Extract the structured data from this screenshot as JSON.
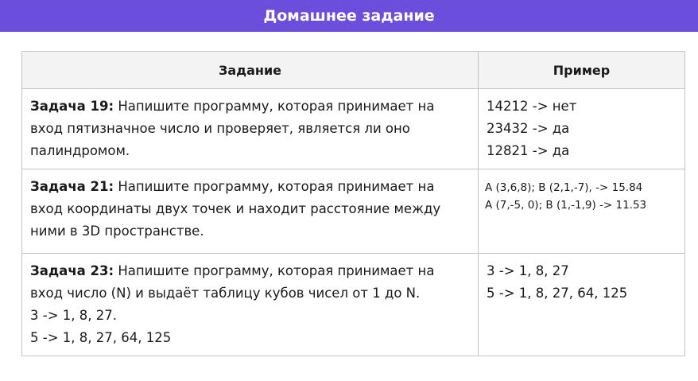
{
  "header": {
    "title": "Домашнее задание"
  },
  "table": {
    "columns": [
      "Задание",
      "Пример"
    ],
    "rows": [
      {
        "label": "Задача 19:",
        "text": " Напишите программу, которая принимает на вход пятизначное число и проверяет, является ли оно палиндромом.",
        "examples": [
          "14212 -> нет",
          "23432 -> да",
          "12821 -> да"
        ]
      },
      {
        "label": "Задача 21:",
        "text": " Напишите программу, которая принимает на вход координаты двух точек и находит расстояние между ними в 3D пространстве.",
        "examples": [
          "A (3,6,8); B (2,1,-7), -> 15.84",
          "A (7,-5, 0); B (1,-1,9) -> 11.53"
        ]
      },
      {
        "label": "Задача 23:",
        "text": " Напишите программу, которая принимает на вход число (N) и выдаёт таблицу кубов чисел от 1 до N.",
        "extra": [
          "3 -> 1, 8, 27.",
          "5 -> 1, 8, 27, 64, 125"
        ],
        "examples": [
          "3 -> 1, 8, 27",
          "5 -> 1, 8, 27, 64, 125"
        ]
      }
    ]
  }
}
